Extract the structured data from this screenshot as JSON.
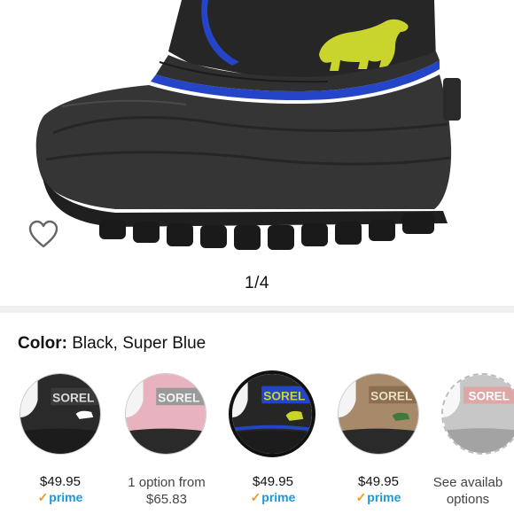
{
  "product": {
    "image_alt": "Sorel kids snow boot, Black / Super Blue",
    "pager": "1/4",
    "favorite_icon": "heart-outline-icon"
  },
  "color": {
    "label": "Color:",
    "value": "Black, Super Blue"
  },
  "swatches": [
    {
      "brand": "SOREL",
      "price": "$49.95",
      "prime": "prime",
      "selected": false
    },
    {
      "brand": "SOREL",
      "line1": "1 option from",
      "line2": "$65.83",
      "selected": false
    },
    {
      "brand": "SOREL",
      "price": "$49.95",
      "prime": "prime",
      "selected": true
    },
    {
      "brand": "SOREL",
      "price": "$49.95",
      "prime": "prime",
      "selected": false
    },
    {
      "brand": "SOREL",
      "line1": "See availab",
      "line2": "options",
      "selected": false
    }
  ],
  "colors": {
    "boot_black": "#2b2b2b",
    "rubber": "#3a3a3a",
    "blue_trim": "#2545c9",
    "bear_yellow": "#c9d52c",
    "prime_blue": "#1a98d5",
    "prime_check": "#f39a1f"
  }
}
